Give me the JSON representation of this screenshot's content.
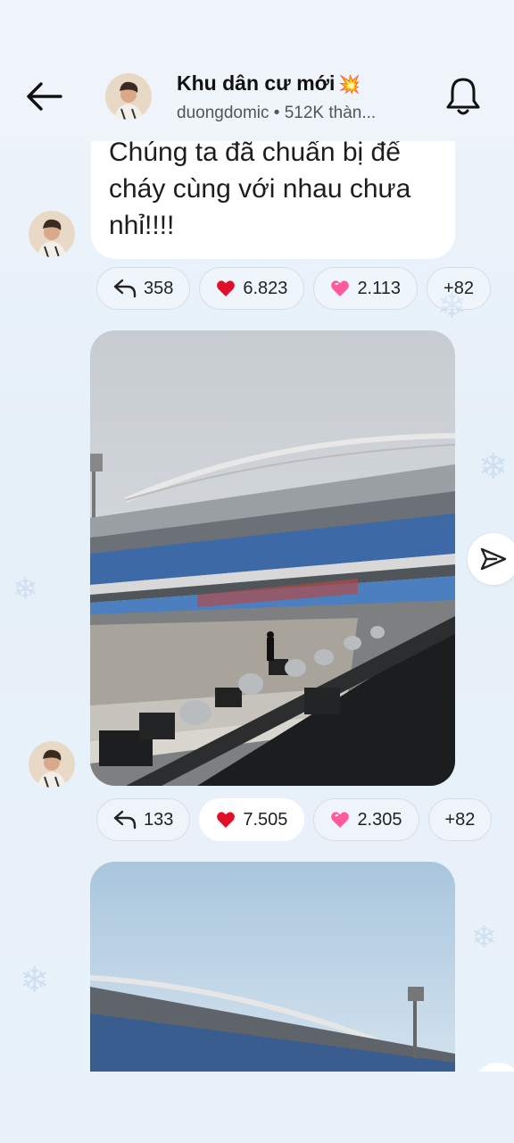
{
  "header": {
    "back_icon": "arrow-left-icon",
    "channel_name": "Khu dân cư mới",
    "channel_emoji": "💥",
    "subtitle": "duongdomic • 512K thàn...",
    "bell_icon": "bell-icon"
  },
  "message1": {
    "text": "Chúng ta đã chuẩn bị để cháy cùng với nhau chưa nhỉ!!!!",
    "reactions": [
      {
        "icon": "reply-icon",
        "count": "358"
      },
      {
        "icon": "red-heart",
        "emoji": "❤️",
        "count": "6.823"
      },
      {
        "icon": "pink-heart",
        "emoji": "💗",
        "count": "2.113"
      },
      {
        "label": "+82"
      }
    ]
  },
  "message2": {
    "image": "stadium-photo",
    "reactions": [
      {
        "icon": "reply-icon",
        "count": "133"
      },
      {
        "icon": "red-heart",
        "emoji": "❤️",
        "count": "7.505"
      },
      {
        "icon": "pink-heart",
        "emoji": "💗",
        "count": "2.305"
      },
      {
        "label": "+82"
      }
    ]
  },
  "message3": {
    "image": "stadium-photo-2"
  },
  "colors": {
    "background": "#eef4fa",
    "bubble": "#ffffff",
    "heart_red": "#e0102a",
    "heart_pink": "#ff5a9a"
  }
}
